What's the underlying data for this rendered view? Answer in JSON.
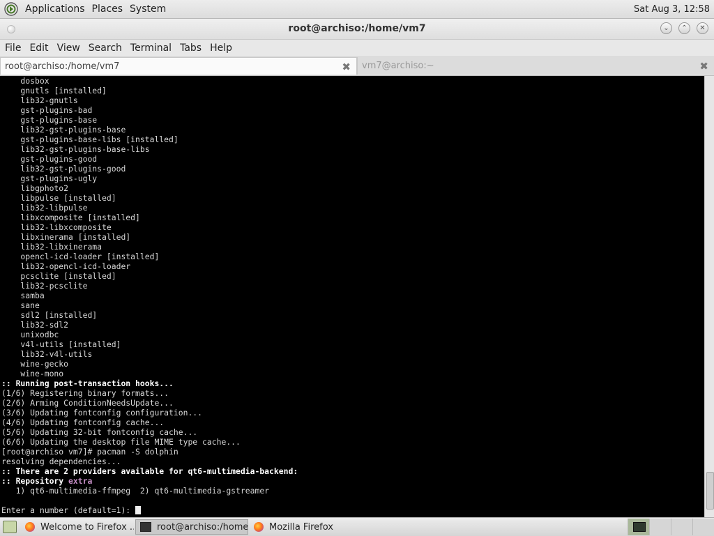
{
  "top_panel": {
    "menus": [
      "Applications",
      "Places",
      "System"
    ],
    "clock": "Sat Aug  3, 12:58"
  },
  "window": {
    "title": "root@archiso:/home/vm7"
  },
  "menubar": [
    "File",
    "Edit",
    "View",
    "Search",
    "Terminal",
    "Tabs",
    "Help"
  ],
  "tabs": [
    {
      "label": "root@archiso:/home/vm7",
      "active": true
    },
    {
      "label": "vm7@archiso:~",
      "active": false
    }
  ],
  "terminal": {
    "lines": [
      {
        "text": "    dosbox",
        "style": ""
      },
      {
        "text": "    gnutls [installed]",
        "style": ""
      },
      {
        "text": "    lib32-gnutls",
        "style": ""
      },
      {
        "text": "    gst-plugins-bad",
        "style": ""
      },
      {
        "text": "    gst-plugins-base",
        "style": ""
      },
      {
        "text": "    lib32-gst-plugins-base",
        "style": ""
      },
      {
        "text": "    gst-plugins-base-libs [installed]",
        "style": ""
      },
      {
        "text": "    lib32-gst-plugins-base-libs",
        "style": ""
      },
      {
        "text": "    gst-plugins-good",
        "style": ""
      },
      {
        "text": "    lib32-gst-plugins-good",
        "style": ""
      },
      {
        "text": "    gst-plugins-ugly",
        "style": ""
      },
      {
        "text": "    libgphoto2",
        "style": ""
      },
      {
        "text": "    libpulse [installed]",
        "style": ""
      },
      {
        "text": "    lib32-libpulse",
        "style": ""
      },
      {
        "text": "    libxcomposite [installed]",
        "style": ""
      },
      {
        "text": "    lib32-libxcomposite",
        "style": ""
      },
      {
        "text": "    libxinerama [installed]",
        "style": ""
      },
      {
        "text": "    lib32-libxinerama",
        "style": ""
      },
      {
        "text": "    opencl-icd-loader [installed]",
        "style": ""
      },
      {
        "text": "    lib32-opencl-icd-loader",
        "style": ""
      },
      {
        "text": "    pcsclite [installed]",
        "style": ""
      },
      {
        "text": "    lib32-pcsclite",
        "style": ""
      },
      {
        "text": "    samba",
        "style": ""
      },
      {
        "text": "    sane",
        "style": ""
      },
      {
        "text": "    sdl2 [installed]",
        "style": ""
      },
      {
        "text": "    lib32-sdl2",
        "style": ""
      },
      {
        "text": "    unixodbc",
        "style": ""
      },
      {
        "text": "    v4l-utils [installed]",
        "style": ""
      },
      {
        "text": "    lib32-v4l-utils",
        "style": ""
      },
      {
        "text": "    wine-gecko",
        "style": ""
      },
      {
        "text": "    wine-mono",
        "style": ""
      },
      {
        "text": ":: Running post-transaction hooks...",
        "style": "b"
      },
      {
        "text": "(1/6) Registering binary formats...",
        "style": ""
      },
      {
        "text": "(2/6) Arming ConditionNeedsUpdate...",
        "style": ""
      },
      {
        "text": "(3/6) Updating fontconfig configuration...",
        "style": ""
      },
      {
        "text": "(4/6) Updating fontconfig cache...",
        "style": ""
      },
      {
        "text": "(5/6) Updating 32-bit fontconfig cache...",
        "style": ""
      },
      {
        "text": "(6/6) Updating the desktop file MIME type cache...",
        "style": ""
      },
      {
        "text": "[root@archiso vm7]# pacman -S dolphin",
        "style": ""
      },
      {
        "text": "resolving dependencies...",
        "style": ""
      },
      {
        "text": ":: There are 2 providers available for qt6-multimedia-backend:",
        "style": "b"
      },
      {
        "text": ":: Repository ",
        "style": "b",
        "suffix": "extra"
      },
      {
        "text": "   1) qt6-multimedia-ffmpeg  2) qt6-multimedia-gstreamer",
        "style": ""
      },
      {
        "text": "",
        "style": ""
      },
      {
        "text": "Enter a number (default=1): ",
        "style": "",
        "cursor": true
      }
    ]
  },
  "taskbar": {
    "items": [
      {
        "label": "Welcome to Firefox ...",
        "icon": "firefox-icon",
        "active": false
      },
      {
        "label": "root@archiso:/home/...",
        "icon": "terminal-icon",
        "active": true
      },
      {
        "label": "Mozilla Firefox",
        "icon": "firefox-icon",
        "active": false
      }
    ]
  }
}
